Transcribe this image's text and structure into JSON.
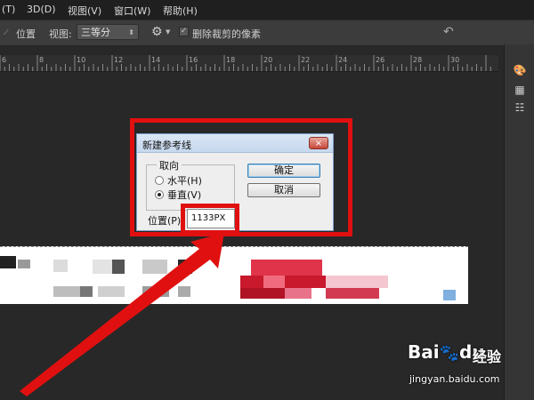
{
  "menu": [
    "(T)",
    "3D(D)",
    "视图(V)",
    "窗口(W)",
    "帮助(H)"
  ],
  "options": {
    "position_label": "位置",
    "view_label": "视图:",
    "view_value": "三等分",
    "checkbox_label": "删除裁剪的像素",
    "checkbox_checked": true
  },
  "ruler": {
    "labels": [
      "6",
      "8",
      "10",
      "12",
      "14",
      "16",
      "18",
      "20",
      "22",
      "24",
      "26",
      "28",
      "30"
    ]
  },
  "dialog": {
    "title": "新建参考线",
    "close": "×",
    "orientation_label": "取向",
    "horizontal_label": "水平(H)",
    "vertical_label": "垂直(V)",
    "selected": "vertical",
    "ok_label": "确定",
    "cancel_label": "取消",
    "position_label": "位置(P):",
    "position_value": "1133PX"
  },
  "watermark": {
    "logo_text": "Bai",
    "logo_du": "du",
    "jingyan": "经验",
    "url": "jingyan.baidu.com"
  },
  "colors": {
    "highlight": "#e01010",
    "workspace": "#282828",
    "menubar": "#1f1f1f",
    "optionsbar": "#3c3c3c"
  }
}
